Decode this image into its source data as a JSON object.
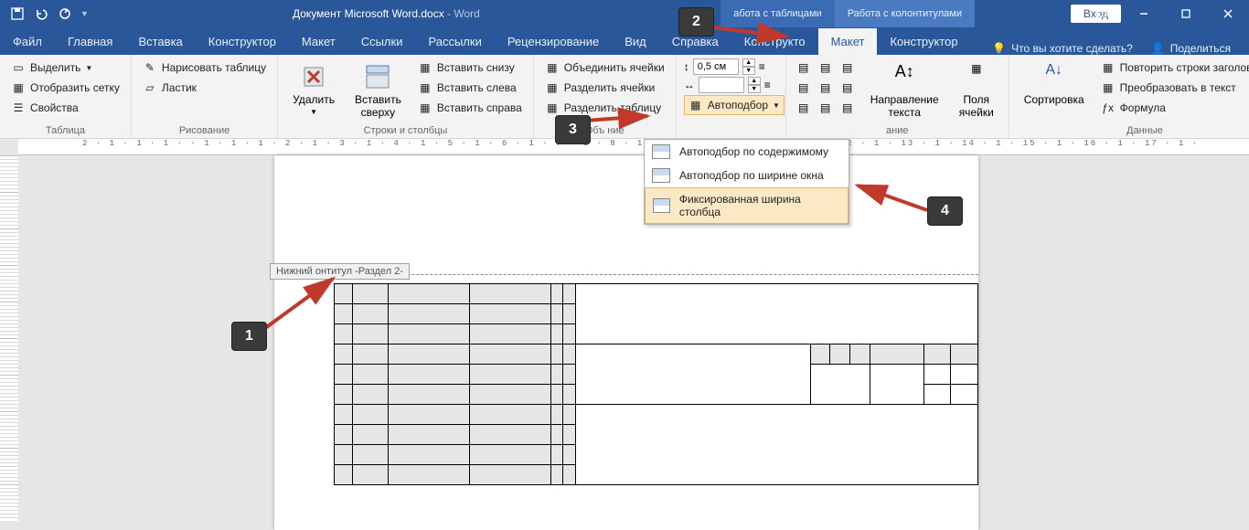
{
  "title": {
    "filename": "Документ Microsoft Word.docx",
    "sep": " - ",
    "app": "Word"
  },
  "context_tabs": [
    "абота с таблицами",
    "Работа с колонтитулами"
  ],
  "login": "Вход",
  "menubar": [
    "Файл",
    "Главная",
    "Вставка",
    "Конструктор",
    "Макет",
    "Ссылки",
    "Рассылки",
    "Рецензирование",
    "Вид",
    "Справка",
    "Конструкто",
    "Макет",
    "Конструктор"
  ],
  "menubar_right": {
    "search": "Что вы хотите сделать?",
    "share": "Поделиться"
  },
  "ribbon": {
    "groups": {
      "table": {
        "label": "Таблица",
        "select": "Выделить",
        "grid": "Отобразить сетку",
        "props": "Свойства"
      },
      "draw": {
        "label": "Рисование",
        "draw": "Нарисовать таблицу",
        "eraser": "Ластик"
      },
      "rowscols": {
        "label": "Строки и столбцы",
        "delete": "Удалить",
        "insert_above": "Вставить\nсверху",
        "insert_below": "Вставить снизу",
        "insert_left": "Вставить слева",
        "insert_right": "Вставить справа"
      },
      "merge": {
        "label": "Объ       ние",
        "merge": "Объединить ячейки",
        "split": "Разделить ячейки",
        "split_table": "Разделить таблицу"
      },
      "cellsize": {
        "label": "",
        "height": "0,5 см",
        "width": "",
        "autofit": "Автоподбор"
      },
      "align": {
        "label": "ание",
        "dir": "Направление\nтекста",
        "margins": "Поля\nячейки"
      },
      "data": {
        "label": "Данные",
        "sort": "Сортировка",
        "repeat": "Повторить строки заголовков",
        "convert": "Преобразовать в текст",
        "formula": "Формула"
      }
    }
  },
  "dropdown": {
    "items": [
      "Автоподбор по содержимому",
      "Автоподбор по ширине окна",
      "Фиксированная ширина столбца"
    ],
    "selected": 2
  },
  "footer_tag": "Нижний      онтитул -Раздел 2-",
  "callouts": {
    "1": "1",
    "2": "2",
    "3": "3",
    "4": "4"
  }
}
